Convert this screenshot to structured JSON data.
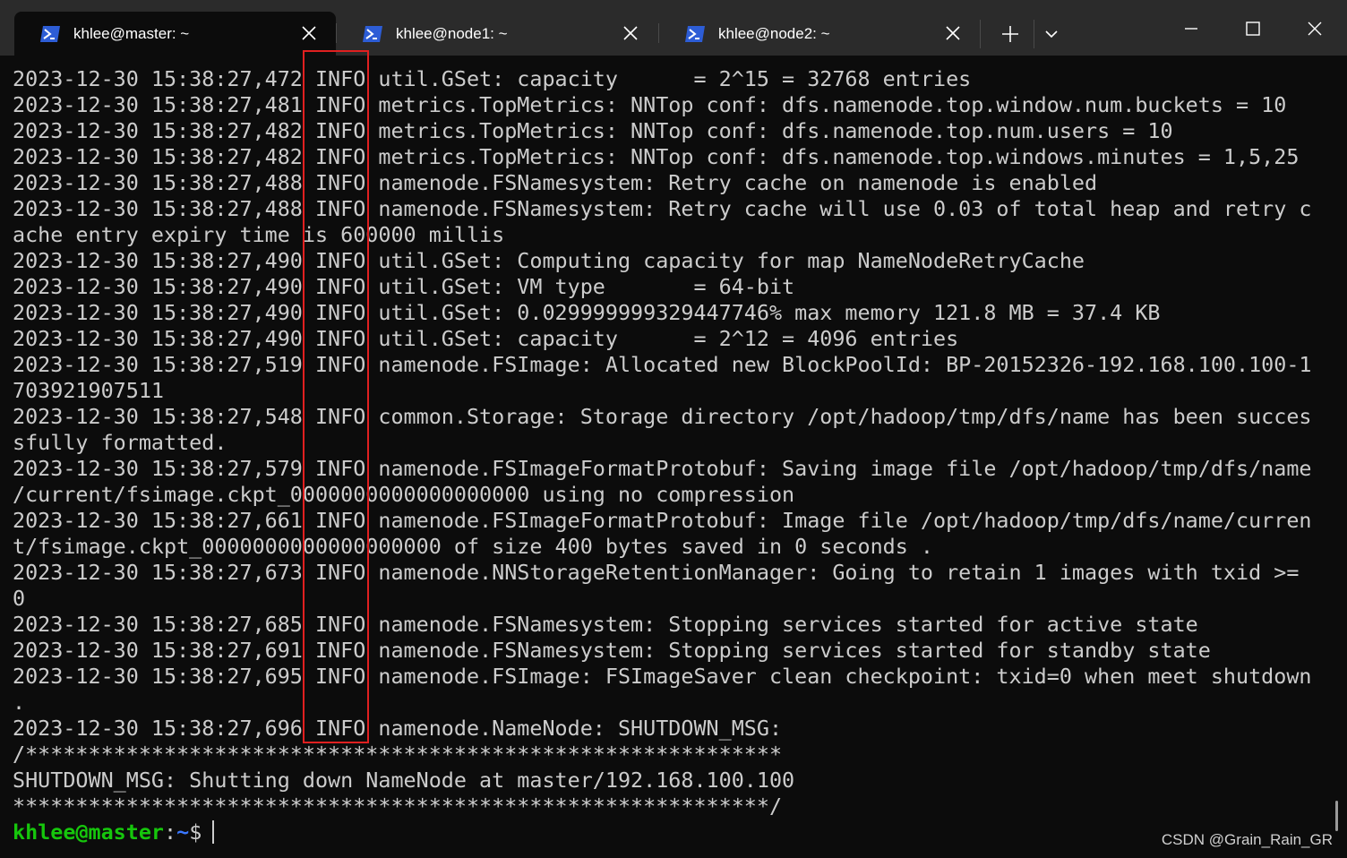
{
  "tabs": [
    {
      "title": "khlee@master: ~",
      "active": true,
      "icon": "powershell-icon"
    },
    {
      "title": "khlee@node1: ~",
      "active": false,
      "icon": "powershell-icon"
    },
    {
      "title": "khlee@node2: ~",
      "active": false,
      "icon": "powershell-icon"
    }
  ],
  "colors": {
    "background": "#0c0c0c",
    "titlebar": "#2b2b2b",
    "text": "#cccccc",
    "prompt_user": "#16c60c",
    "prompt_path": "#3b78ff",
    "highlight": "#e02020",
    "ps_icon": "#2d5dd6"
  },
  "terminal": {
    "lines": [
      "2023-12-30 15:38:27,472 INFO util.GSet: capacity      = 2^15 = 32768 entries",
      "2023-12-30 15:38:27,481 INFO metrics.TopMetrics: NNTop conf: dfs.namenode.top.window.num.buckets = 10",
      "2023-12-30 15:38:27,482 INFO metrics.TopMetrics: NNTop conf: dfs.namenode.top.num.users = 10",
      "2023-12-30 15:38:27,482 INFO metrics.TopMetrics: NNTop conf: dfs.namenode.top.windows.minutes = 1,5,25",
      "2023-12-30 15:38:27,488 INFO namenode.FSNamesystem: Retry cache on namenode is enabled",
      "2023-12-30 15:38:27,488 INFO namenode.FSNamesystem: Retry cache will use 0.03 of total heap and retry c",
      "ache entry expiry time is 600000 millis",
      "2023-12-30 15:38:27,490 INFO util.GSet: Computing capacity for map NameNodeRetryCache",
      "2023-12-30 15:38:27,490 INFO util.GSet: VM type       = 64-bit",
      "2023-12-30 15:38:27,490 INFO util.GSet: 0.029999999329447746% max memory 121.8 MB = 37.4 KB",
      "2023-12-30 15:38:27,490 INFO util.GSet: capacity      = 2^12 = 4096 entries",
      "2023-12-30 15:38:27,519 INFO namenode.FSImage: Allocated new BlockPoolId: BP-20152326-192.168.100.100-1",
      "703921907511",
      "2023-12-30 15:38:27,548 INFO common.Storage: Storage directory /opt/hadoop/tmp/dfs/name has been succes",
      "sfully formatted.",
      "2023-12-30 15:38:27,579 INFO namenode.FSImageFormatProtobuf: Saving image file /opt/hadoop/tmp/dfs/name",
      "/current/fsimage.ckpt_0000000000000000000 using no compression",
      "2023-12-30 15:38:27,661 INFO namenode.FSImageFormatProtobuf: Image file /opt/hadoop/tmp/dfs/name/curren",
      "t/fsimage.ckpt_0000000000000000000 of size 400 bytes saved in 0 seconds .",
      "2023-12-30 15:38:27,673 INFO namenode.NNStorageRetentionManager: Going to retain 1 images with txid >=",
      "0",
      "2023-12-30 15:38:27,685 INFO namenode.FSNamesystem: Stopping services started for active state",
      "2023-12-30 15:38:27,691 INFO namenode.FSNamesystem: Stopping services started for standby state",
      "2023-12-30 15:38:27,695 INFO namenode.FSImage: FSImageSaver clean checkpoint: txid=0 when meet shutdown",
      ".",
      "2023-12-30 15:38:27,696 INFO namenode.NameNode: SHUTDOWN_MSG:",
      "/************************************************************",
      "SHUTDOWN_MSG: Shutting down NameNode at master/192.168.100.100",
      "************************************************************/"
    ],
    "prompt": {
      "user": "khlee@master",
      "colon": ":",
      "path": "~",
      "symbol": "$"
    }
  },
  "watermark": "CSDN @Grain_Rain_GR"
}
